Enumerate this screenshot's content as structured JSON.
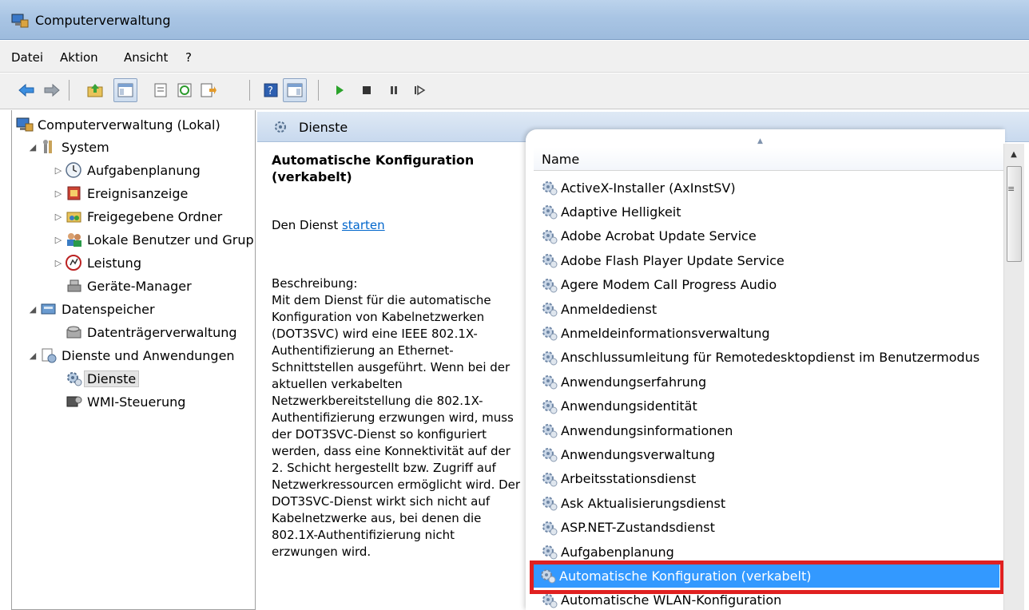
{
  "window": {
    "title": "Computerverwaltung"
  },
  "menu": [
    "Datei",
    "Aktion",
    "Ansicht",
    "?"
  ],
  "toolbar": {
    "buttons": [
      "back-arrow-icon",
      "forward-arrow-icon",
      "up-folder-icon",
      "show-hide-tree-icon",
      "properties-icon",
      "refresh-icon",
      "export-list-icon",
      "help-icon",
      "show-hide-action-pane-icon",
      "play-icon",
      "stop-icon",
      "pause-icon",
      "resume-icon"
    ]
  },
  "tree": {
    "items": [
      {
        "label": "Computerverwaltung (Lokal)",
        "arrow": "",
        "icon": "computer-management-icon"
      },
      {
        "label": "System",
        "arrow": "◢",
        "icon": "system-tools-icon"
      },
      {
        "label": "Aufgabenplanung",
        "arrow": "▷",
        "icon": "clock-icon"
      },
      {
        "label": "Ereignisanzeige",
        "arrow": "▷",
        "icon": "event-viewer-icon"
      },
      {
        "label": "Freigegebene Ordner",
        "arrow": "▷",
        "icon": "shared-folder-icon"
      },
      {
        "label": "Lokale Benutzer und Gruppen",
        "arrow": "▷",
        "icon": "users-icon"
      },
      {
        "label": "Leistung",
        "arrow": "▷",
        "icon": "performance-icon"
      },
      {
        "label": "Geräte-Manager",
        "arrow": "",
        "icon": "device-manager-icon"
      },
      {
        "label": "Datenspeicher",
        "arrow": "◢",
        "icon": "storage-icon"
      },
      {
        "label": "Datenträgerverwaltung",
        "arrow": "",
        "icon": "disk-management-icon"
      },
      {
        "label": "Dienste und Anwendungen",
        "arrow": "◢",
        "icon": "services-apps-icon"
      },
      {
        "label": "Dienste",
        "arrow": "",
        "icon": "services-gear-icon"
      },
      {
        "label": "WMI-Steuerung",
        "arrow": "",
        "icon": "wmi-icon"
      }
    ]
  },
  "content": {
    "header_title": "Dienste",
    "service_title": "Automatische Konfiguration (verkabelt)",
    "start_prefix": "Den Dienst ",
    "start_link": "starten",
    "description_heading": "Beschreibung:",
    "description_text": "Mit dem Dienst für die automatische Konfiguration von Kabelnetzwerken (DOT3SVC) wird eine IEEE 802.1X-Authentifizierung an Ethernet-Schnittstellen ausgeführt. Wenn bei der aktuellen verkabelten Netzwerkbereitstellung die 802.1X-Authentifizierung erzwungen wird, muss der DOT3SVC-Dienst so konfiguriert werden, dass eine Konnektivität auf der 2. Schicht hergestellt bzw. Zugriff auf Netzwerkressourcen ermöglicht wird. Der DOT3SVC-Dienst wirkt sich nicht auf Kabelnetzwerke aus, bei denen die 802.1X-Authentifizierung nicht erzwungen wird."
  },
  "services": {
    "column_name": "Name",
    "selected_index": 16,
    "rows": [
      "ActiveX-Installer (AxInstSV)",
      "Adaptive Helligkeit",
      "Adobe Acrobat Update Service",
      "Adobe Flash Player Update Service",
      "Agere Modem Call Progress Audio",
      "Anmeldedienst",
      "Anmeldeinformationsverwaltung",
      "Anschlussumleitung für Remotedesktopdienst im Benutzermodus",
      "Anwendungserfahrung",
      "Anwendungsidentität",
      "Anwendungsinformationen",
      "Anwendungsverwaltung",
      "Arbeitsstationsdienst",
      "Ask Aktualisierungsdienst",
      "ASP.NET-Zustandsdienst",
      "Aufgabenplanung",
      "Automatische Konfiguration (verkabelt)",
      "Automatische WLAN-Konfiguration"
    ]
  },
  "colors": {
    "selection": "#3399ff",
    "highlight_border": "#e02020",
    "link": "#0066cc"
  }
}
